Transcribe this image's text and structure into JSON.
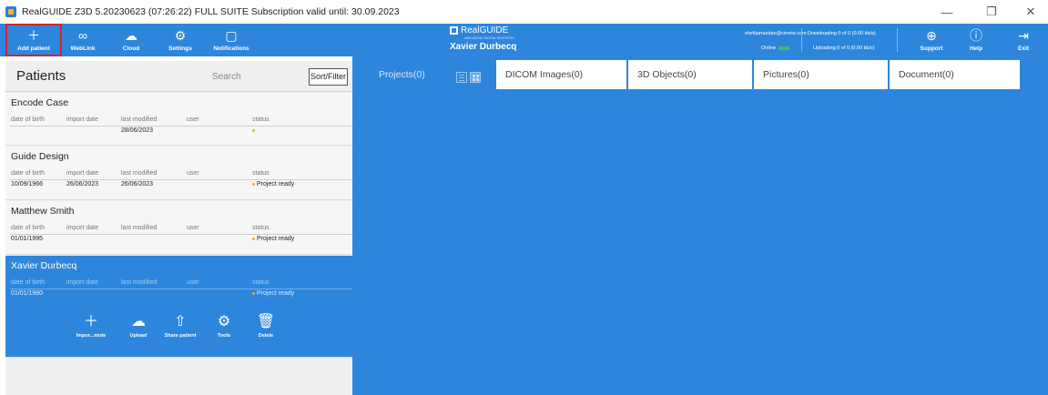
{
  "window": {
    "title": "RealGUIDE Z3D  5.20230623 (07:26:22)  FULL SUITE Subscription valid until: 30.09.2023",
    "minimize_glyph": "—",
    "restore_glyph": "❐",
    "close_glyph": "✕"
  },
  "toolbar": {
    "add_patient": "Add patient",
    "weblink": "WebLink",
    "cloud": "Cloud",
    "settings": "Settings",
    "notifications": "Notifications",
    "brand_name": "RealGUIDE",
    "brand_tagline": "INNOVATIVE DIGITAL DENTISTRY",
    "patient_name": "Xavier Durbecq",
    "user_email": "sheltjarrazdan@cimvie.com",
    "online_label": "Online",
    "downloading": "Downloading 0 of 0 (0.00 kb/s)",
    "uploading": "Uploading 0 of 0 (0.00 kb/s)",
    "support": "Support",
    "help": "Help",
    "exit": "Exit"
  },
  "patients_panel": {
    "title": "Patients",
    "search_placeholder": "Search",
    "sort_filter": "Sort/Filter",
    "field_labels": {
      "dob": "date of birth",
      "import": "import date",
      "modified": "last modified",
      "user": "user",
      "status": "status"
    },
    "patients": [
      {
        "name": "Encode Case",
        "dob": "",
        "import_date": "",
        "last_modified": "28/06/2023",
        "user": "",
        "status": ""
      },
      {
        "name": "Guide Design",
        "dob": "10/09/1966",
        "import_date": "26/06/2023",
        "last_modified": "26/06/2023",
        "user": "",
        "status": "Project ready"
      },
      {
        "name": "Matthew Smith",
        "dob": "01/01/1995",
        "import_date": "",
        "last_modified": "",
        "user": "",
        "status": "Project ready"
      },
      {
        "name": "Xavier Durbecq",
        "dob": "01/01/1980",
        "import_date": "",
        "last_modified": "",
        "user": "",
        "status": "Project ready"
      }
    ],
    "actions": {
      "import": "Impor...mote",
      "upload": "Upload",
      "share": "Share patient",
      "tools": "Tools",
      "delete": "Delete"
    }
  },
  "tabs": {
    "projects": "Projects(0)",
    "dicom": "DICOM Images(0)",
    "objects": "3D Objects(0)",
    "pictures": "Pictures(0)",
    "document": "Document(0)"
  },
  "icons": {
    "add": "plus-icon",
    "weblink": "link-icon",
    "cloud": "cloud-icon",
    "settings": "gear-icon",
    "notifications": "notification-icon",
    "support": "globe-icon",
    "help": "help-icon",
    "exit": "exit-icon"
  },
  "colors": {
    "accent": "#2d86dc",
    "highlight_border": "#d3252b",
    "online": "#3fbf5d"
  }
}
